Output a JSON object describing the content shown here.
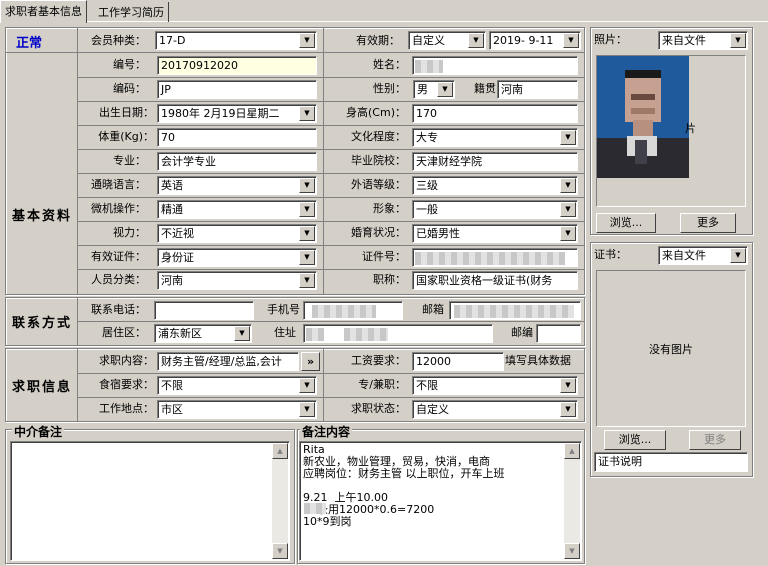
{
  "tabs": [
    {
      "label": "求职者基本信息"
    },
    {
      "label": "工作学习简历"
    }
  ],
  "status": "正常",
  "status_color": "#0000c8",
  "member": {
    "label": "会员种类：",
    "value": "17-D"
  },
  "validity": {
    "label": "有效期：",
    "type": "自定义",
    "date": "2019- 9-11"
  },
  "sections": {
    "basic": "基本资料",
    "contact": "联系方式",
    "job": "求职信息"
  },
  "basic": {
    "id": {
      "label": "编号：",
      "value": "20170912020"
    },
    "name": {
      "label": "姓名："
    },
    "code": {
      "label": "编码：",
      "value": "JP"
    },
    "gender": {
      "label": "性别：",
      "value": "男"
    },
    "origin": {
      "label": "籍贯",
      "value": "河南"
    },
    "birth": {
      "label": "出生日期：",
      "value": "1980年 2月19日星期二"
    },
    "height": {
      "label": "身高(Cm)：",
      "value": "170"
    },
    "weight": {
      "label": "体重(Kg)：",
      "value": "70"
    },
    "education": {
      "label": "文化程度：",
      "value": "大专"
    },
    "major": {
      "label": "专业：",
      "value": "会计学专业"
    },
    "school": {
      "label": "毕业院校：",
      "value": "天津财经学院"
    },
    "language": {
      "label": "通晓语言：",
      "value": "英语"
    },
    "lang_level": {
      "label": "外语等级：",
      "value": "三级"
    },
    "computer": {
      "label": "微机操作：",
      "value": "精通"
    },
    "image": {
      "label": "形象：",
      "value": "一般"
    },
    "vision": {
      "label": "视力：",
      "value": "不近视"
    },
    "marriage": {
      "label": "婚育状况：",
      "value": "已婚男性"
    },
    "id_type": {
      "label": "有效证件：",
      "value": "身份证"
    },
    "id_no": {
      "label": "证件号："
    },
    "category": {
      "label": "人员分类：",
      "value": "河南"
    },
    "title": {
      "label": "职称：",
      "value": "国家职业资格一级证书(财务"
    }
  },
  "contact": {
    "phone": {
      "label": "联系电话："
    },
    "mobile": {
      "label": "手机号"
    },
    "email": {
      "label": "邮箱"
    },
    "district": {
      "label": "居住区：",
      "value": "浦东新区"
    },
    "address": {
      "label": "住址"
    },
    "zip": {
      "label": "邮编"
    }
  },
  "job": {
    "content": {
      "label": "求职内容：",
      "value": "财务主管/经理/总监,会计",
      "more": "»"
    },
    "salary": {
      "label": "工资要求：",
      "value": "12000",
      "note": "填写具体数据"
    },
    "lodging": {
      "label": "食宿要求：",
      "value": "不限"
    },
    "parttime": {
      "label": "专/兼职：",
      "value": "不限"
    },
    "location": {
      "label": "工作地点：",
      "value": "市区"
    },
    "status": {
      "label": "求职状态：",
      "value": "自定义"
    }
  },
  "agent_note": {
    "title": "中介备注",
    "text": ""
  },
  "remark": {
    "title": "备注内容",
    "text": "Rita\n新农业，物业管理，贸易，快消，电商\n应聘岗位：财务主管 以上职位，开车上班\n\n9.21  上午10.00\n    录用12000*0.6=7200\n10*9到岗"
  },
  "photo": {
    "label": "照片：",
    "source": "来自文件",
    "browse": "浏览...",
    "more": "更多",
    "overlay_char": "片"
  },
  "cert": {
    "label": "证书：",
    "source": "来自文件",
    "placeholder": "没有图片",
    "browse": "浏览...",
    "more": "更多",
    "desc": "证书说明"
  },
  "colors": {
    "face": "#d4d0c8",
    "highlight_field": "#ffffe1",
    "photo_bg": "#1e5a9c"
  }
}
